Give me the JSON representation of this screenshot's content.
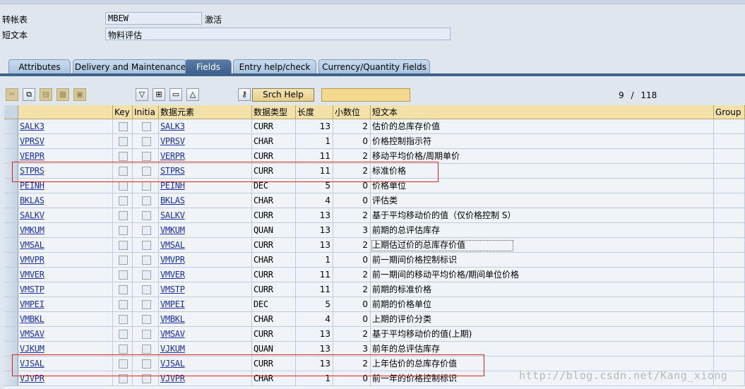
{
  "header": {
    "table_label": "转帐表",
    "table_value": "MBEW",
    "status": "激活",
    "short_text_label": "短文本",
    "short_text_value": "物料评估"
  },
  "tabs": [
    {
      "label": "Attributes",
      "active": false
    },
    {
      "label": "Delivery and Maintenance",
      "active": false
    },
    {
      "label": "Fields",
      "active": true
    },
    {
      "label": "Entry help/check",
      "active": false
    },
    {
      "label": "Currency/Quantity Fields",
      "active": false
    }
  ],
  "toolbar": {
    "srch_help": "Srch Help",
    "pager_current": "9",
    "pager_sep": "/",
    "pager_total": "118",
    "icons": [
      "cut-icon",
      "copy-icon",
      "paste-icon",
      "insert-row-icon",
      "delete-row-icon",
      "filter-icon",
      "new-entry-icon",
      "details-icon",
      "sort-icon",
      "key-icon"
    ]
  },
  "columns": [
    "",
    "Key",
    "Initia",
    "数据元素",
    "数据类型",
    "长度",
    "小数位",
    "短文本",
    "Group"
  ],
  "rows": [
    {
      "field": "SALK3",
      "elem": "SALK3",
      "type": "CURR",
      "len": "13",
      "dec": "2",
      "text": "估价的总库存价值"
    },
    {
      "field": "VPRSV",
      "elem": "VPRSV",
      "type": "CHAR",
      "len": "1",
      "dec": "0",
      "text": "价格控制指示符"
    },
    {
      "field": "VERPR",
      "elem": "VERPR",
      "type": "CURR",
      "len": "11",
      "dec": "2",
      "text": "移动平均价格/周期单价"
    },
    {
      "field": "STPRS",
      "elem": "STPRS",
      "type": "CURR",
      "len": "11",
      "dec": "2",
      "text": "标准价格"
    },
    {
      "field": "PEINH",
      "elem": "PEINH",
      "type": "DEC",
      "len": "5",
      "dec": "0",
      "text": "价格单位"
    },
    {
      "field": "BKLAS",
      "elem": "BKLAS",
      "type": "CHAR",
      "len": "4",
      "dec": "0",
      "text": "评估类"
    },
    {
      "field": "SALKV",
      "elem": "SALKV",
      "type": "CURR",
      "len": "13",
      "dec": "2",
      "text": "基于平均移动价的值（仅价格控制 S）"
    },
    {
      "field": "VMKUM",
      "elem": "VMKUM",
      "type": "QUAN",
      "len": "13",
      "dec": "3",
      "text": "前期的总评估库存"
    },
    {
      "field": "VMSAL",
      "elem": "VMSAL",
      "type": "CURR",
      "len": "13",
      "dec": "2",
      "text": "上期估过价的总库存价值"
    },
    {
      "field": "VMVPR",
      "elem": "VMVPR",
      "type": "CHAR",
      "len": "1",
      "dec": "0",
      "text": "前一期间价格控制标识"
    },
    {
      "field": "VMVER",
      "elem": "VMVER",
      "type": "CURR",
      "len": "11",
      "dec": "2",
      "text": "前一期间的移动平均价格/期间单位价格"
    },
    {
      "field": "VMSTP",
      "elem": "VMSTP",
      "type": "CURR",
      "len": "11",
      "dec": "2",
      "text": "前期的标准价格"
    },
    {
      "field": "VMPEI",
      "elem": "VMPEI",
      "type": "DEC",
      "len": "5",
      "dec": "0",
      "text": "前期的价格单位"
    },
    {
      "field": "VMBKL",
      "elem": "VMBKL",
      "type": "CHAR",
      "len": "4",
      "dec": "0",
      "text": "上期的评价分类"
    },
    {
      "field": "VMSAV",
      "elem": "VMSAV",
      "type": "CURR",
      "len": "13",
      "dec": "2",
      "text": "基于平均移动价的值(上期)"
    },
    {
      "field": "VJKUM",
      "elem": "VJKUM",
      "type": "QUAN",
      "len": "13",
      "dec": "3",
      "text": "前年的总评估库存"
    },
    {
      "field": "VJSAL",
      "elem": "VJSAL",
      "type": "CURR",
      "len": "13",
      "dec": "2",
      "text": "上年估价的总库存价值"
    },
    {
      "field": "VJVPR",
      "elem": "VJVPR",
      "type": "CHAR",
      "len": "1",
      "dec": "0",
      "text": "前一年的价格控制标识"
    }
  ],
  "watermark": "http://blog.csdn.net/Kang_xiong",
  "highlight_color": "#e0211d"
}
